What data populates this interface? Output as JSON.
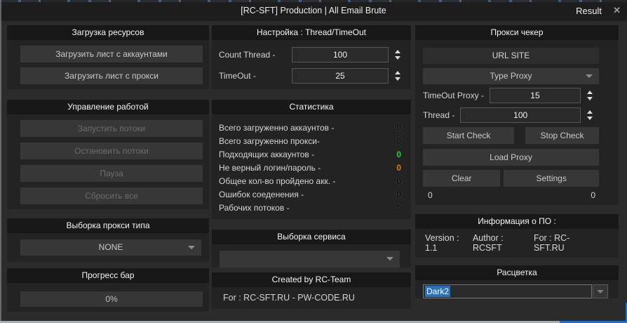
{
  "window": {
    "title": "[RC-SFT] Production | All Email Brute",
    "result_label": "Result",
    "close_glyph": "✕"
  },
  "left": {
    "resources": {
      "header": "Загрузка ресурсов",
      "load_accounts": "Загрузить лист с аккаунтами",
      "load_proxy": "Загрузить лист с прокси"
    },
    "control": {
      "header": "Управление работой",
      "start": "Запустить потоки",
      "stop": "Остановить потоки",
      "pause": "Пауза",
      "reset": "Сбросить все"
    },
    "proxy_type": {
      "header": "Выборка прокси типа",
      "value": "NONE"
    },
    "progress": {
      "header": "Прогресс бар",
      "value": "0%"
    }
  },
  "middle": {
    "settings": {
      "header": "Настройка : Thread/TimeOut",
      "rows": [
        {
          "label": "Count Thread -",
          "value": "100"
        },
        {
          "label": "TimeOut -",
          "value": "25"
        }
      ]
    },
    "stats": {
      "header": "Статистика",
      "rows": [
        {
          "label": "Всего загруженно аккаунтов -",
          "value": "0",
          "color": "black"
        },
        {
          "label": "Всего загруженно прокси-",
          "value": "0",
          "color": "black"
        },
        {
          "label": "Подходящих аккаунтов -",
          "value": "0",
          "color": "green"
        },
        {
          "label": "Не верный логин/пароль -",
          "value": "0",
          "color": "orange"
        },
        {
          "label": "Общее кол-во пройдено акк. -",
          "value": "0",
          "color": "black"
        },
        {
          "label": "Ошибок соеденения -",
          "value": "0",
          "color": "black"
        },
        {
          "label": "Рабочих потоков -",
          "value": "0",
          "color": "black"
        }
      ]
    },
    "service": {
      "header": "Выборка сервиса",
      "value": ""
    },
    "created": {
      "header": "Created by RC-Team",
      "text": "For : RC-SFT.RU - PW-CODE.RU"
    }
  },
  "right": {
    "checker": {
      "header": "Прокси чекер",
      "url_site": "URL SITE",
      "type_proxy": "Type Proxy",
      "timeout_label": "TimeOut Proxy -",
      "timeout_value": "15",
      "thread_label": "Thread -",
      "thread_value": "100",
      "start_check": "Start Check",
      "stop_check": "Stop Check",
      "load_proxy": "Load Proxy",
      "clear": "Clear",
      "settings": "Settings",
      "counter_left": "0",
      "counter_right": "0"
    },
    "info": {
      "header": "Информация о ПО :",
      "version": "Version : 1.1",
      "author": "Author : RCSFT",
      "site": "For : RC-SFT.RU"
    },
    "theme": {
      "header": "Расцветка",
      "value": "Dark2"
    }
  },
  "colors": {
    "stat_green": "#2cc82c",
    "stat_orange": "#e0761a",
    "selection_blue": "#2a71bd",
    "window_border_blue": "#1e6fc8"
  }
}
